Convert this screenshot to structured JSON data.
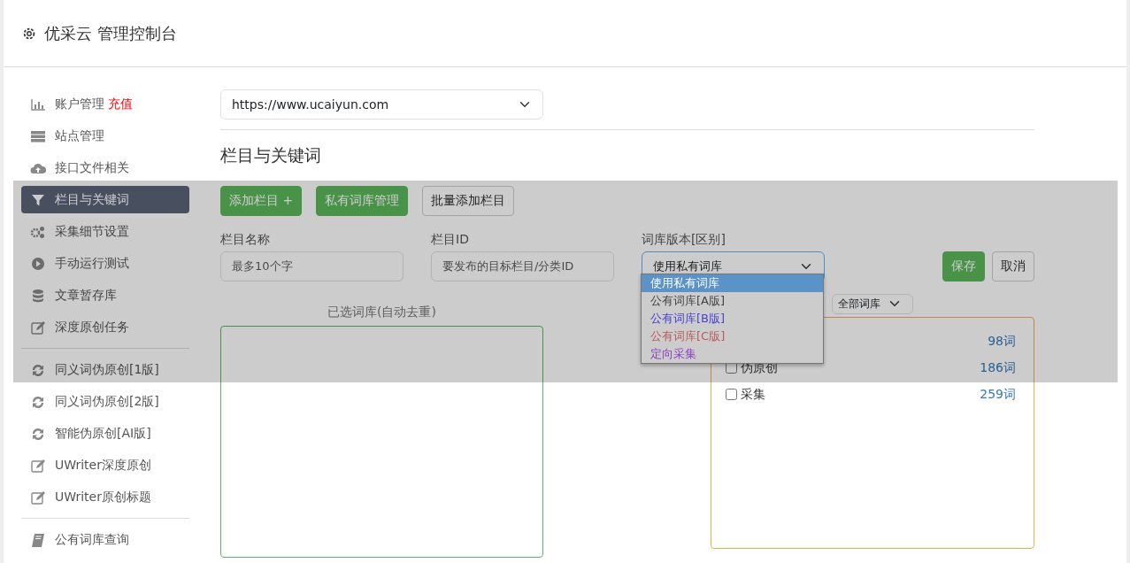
{
  "header": {
    "title": "优采云 管理控制台"
  },
  "sidebar": {
    "groups": [
      {
        "items": [
          {
            "kind": "chart",
            "label": "账户管理",
            "badge": "充值",
            "selected": false
          },
          {
            "kind": "server",
            "label": "站点管理",
            "selected": false
          },
          {
            "kind": "cloud",
            "label": "接口文件相关",
            "selected": false
          },
          {
            "kind": "filter",
            "label": "栏目与关键词",
            "selected": true
          },
          {
            "kind": "gears",
            "label": "采集细节设置",
            "selected": false
          },
          {
            "kind": "play",
            "label": "手动运行测试",
            "selected": false
          },
          {
            "kind": "database",
            "label": "文章暂存库",
            "selected": false
          },
          {
            "kind": "edit",
            "label": "深度原创任务",
            "selected": false
          }
        ]
      },
      {
        "items": [
          {
            "kind": "refresh",
            "label": "同义词伪原创[1版]",
            "selected": false
          },
          {
            "kind": "refresh",
            "label": "同义词伪原创[2版]",
            "selected": false
          },
          {
            "kind": "refresh",
            "label": "智能伪原创[AI版]",
            "selected": false
          },
          {
            "kind": "edit",
            "label": "UWriter深度原创",
            "selected": false
          },
          {
            "kind": "edit",
            "label": "UWriter原创标题",
            "selected": false
          }
        ]
      },
      {
        "items": [
          {
            "kind": "book",
            "label": "公有词库查询",
            "selected": false
          }
        ]
      }
    ]
  },
  "site_select": {
    "value": "https://www.ucaiyun.com"
  },
  "section_title": "栏目与关键词",
  "toolbar": [
    {
      "label": "添加栏目 +",
      "kind": "success"
    },
    {
      "label": "私有词库管理",
      "kind": "success"
    },
    {
      "label": "批量添加栏目",
      "kind": "outline"
    }
  ],
  "form": {
    "fields": [
      {
        "label": "栏目名称",
        "placeholder": "最多10个字"
      },
      {
        "label": "栏目ID",
        "placeholder": "要发布的目标栏目/分类ID"
      }
    ],
    "library_version": {
      "label": "词库版本[区别]",
      "value": "使用私有词库",
      "options": [
        {
          "label": "使用私有词库",
          "selected": true
        },
        {
          "label": "公有词库[A版]",
          "selected": false,
          "color": "#444444"
        },
        {
          "label": "公有词库[B版]",
          "selected": false,
          "color": "#4a3fd0"
        },
        {
          "label": "公有词库[C版]",
          "selected": false,
          "color": "#b8595c"
        },
        {
          "label": "定向采集",
          "selected": false,
          "color": "#8a3fc4"
        }
      ]
    },
    "buttons": [
      {
        "label": "保存",
        "kind": "success"
      },
      {
        "label": "取消",
        "kind": "outline"
      }
    ]
  },
  "selected_panel": {
    "title": "已选词库(自动去重)"
  },
  "library_filter": {
    "value": "全部词库"
  },
  "library_list": [
    {
      "count": "98词"
    },
    {
      "label": "伪原创",
      "checked": false,
      "count": "186词"
    },
    {
      "label": "采集",
      "checked": false,
      "count": "259词"
    }
  ]
}
